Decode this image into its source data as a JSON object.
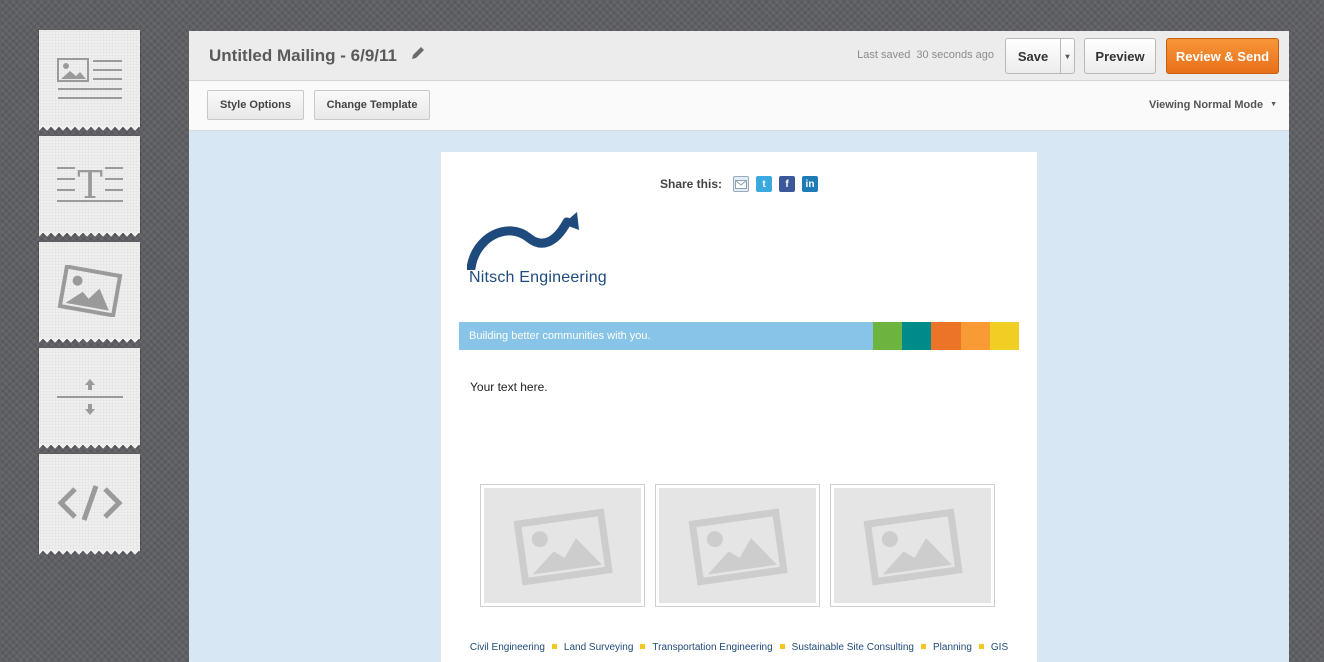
{
  "palette": {
    "items": [
      {
        "name": "image-text-block",
        "icon": "image-text-icon"
      },
      {
        "name": "text-block",
        "icon": "text-icon"
      },
      {
        "name": "image-block",
        "icon": "image-icon"
      },
      {
        "name": "spacer-block",
        "icon": "spacer-icon"
      },
      {
        "name": "code-block",
        "icon": "code-icon"
      }
    ]
  },
  "header": {
    "title": "Untitled Mailing - 6/9/11",
    "last_saved_label": "Last saved",
    "last_saved_value": "30 seconds ago",
    "save_label": "Save",
    "save_dropdown": "▾",
    "preview_label": "Preview",
    "review_label": "Review & Send"
  },
  "toolbar": {
    "style_options_label": "Style Options",
    "change_template_label": "Change Template",
    "viewing_mode_label": "Viewing Normal Mode",
    "viewing_caret": "▼"
  },
  "email": {
    "share_label": "Share this:",
    "share_icons": [
      "email-icon",
      "twitter-icon",
      "facebook-icon",
      "linkedin-icon"
    ],
    "logo_text": "Nitsch Engineering",
    "banner_text": "Building better communities with you.",
    "banner_colors": [
      "#6db33f",
      "#008b8b",
      "#ec7429",
      "#f89b34",
      "#f0ce23"
    ],
    "body_text": "Your text here.",
    "footer_links": [
      "Civil Engineering",
      "Land Surveying",
      "Transportation Engineering",
      "Sustainable Site Consulting",
      "Planning",
      "GIS"
    ]
  },
  "colors": {
    "accent": "#f08528",
    "banner_blue": "#88c4e8",
    "canvas_bg": "#d7e8f4",
    "logo_blue": "#1f4a7c"
  }
}
